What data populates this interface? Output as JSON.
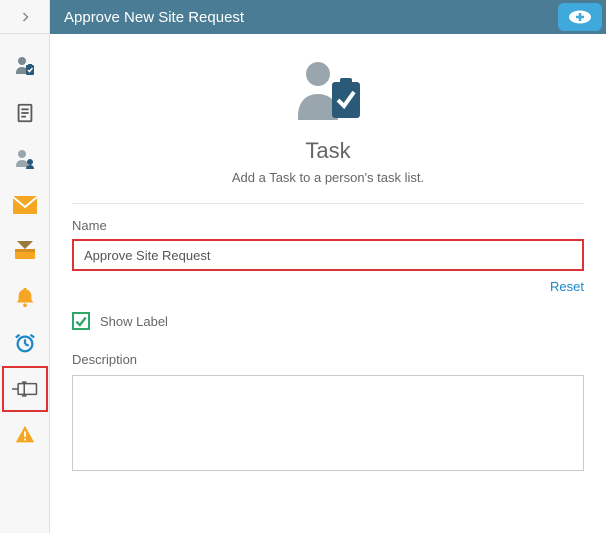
{
  "header": {
    "title": "Approve New Site Request"
  },
  "hero": {
    "title": "Task",
    "subtitle": "Add a Task to a person's task list."
  },
  "fields": {
    "name_label": "Name",
    "name_value": "Approve Site Request",
    "reset_label": "Reset",
    "show_label_text": "Show Label",
    "show_label_checked": true,
    "description_label": "Description",
    "description_value": ""
  },
  "rail": {
    "items": [
      {
        "name": "person-checklist-icon"
      },
      {
        "name": "document-icon"
      },
      {
        "name": "assign-user-icon"
      },
      {
        "name": "mail-icon"
      },
      {
        "name": "inbox-icon"
      },
      {
        "name": "bell-icon"
      },
      {
        "name": "clock-icon"
      },
      {
        "name": "form-field-icon"
      },
      {
        "name": "warning-icon"
      }
    ]
  }
}
